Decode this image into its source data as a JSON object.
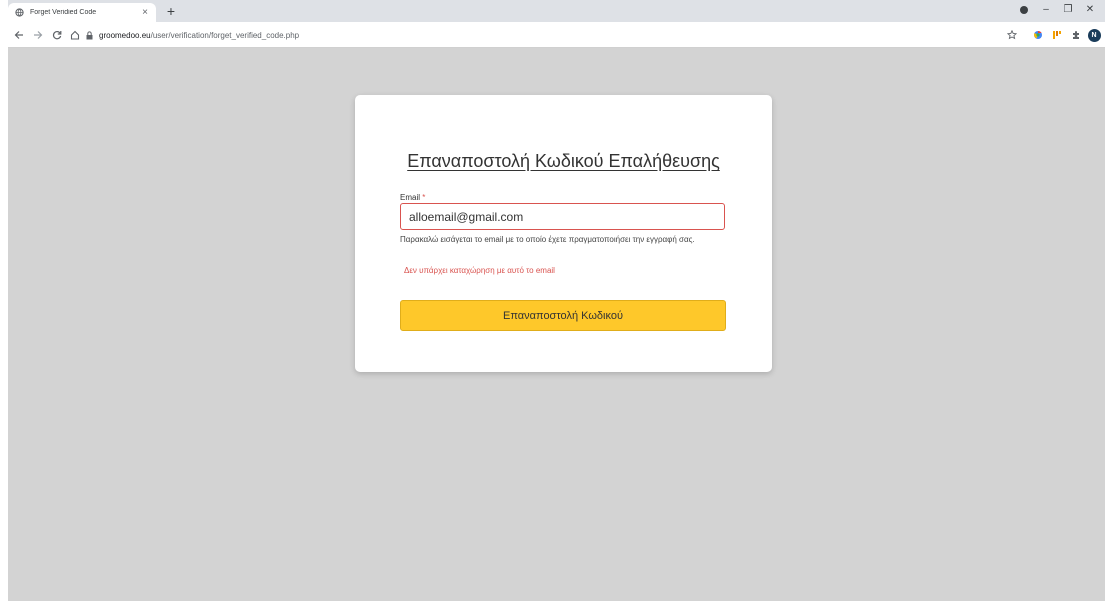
{
  "browser": {
    "tab_title": "Forget Veridied Code",
    "tab_close": "×",
    "new_tab": "+",
    "url_host": "groomedoo.eu",
    "url_path": "/user/verification/forget_verified_code.php",
    "profile_initial": "N",
    "window": {
      "minimize": "–",
      "maximize": "❐",
      "close": "✕"
    }
  },
  "form": {
    "title": "Επαναποστολή Κωδικού Επαλήθευσης",
    "email_label": "Email",
    "required_mark": "*",
    "email_value": "alloemail@gmail.com",
    "help_text": "Παρακαλώ εισάγεται το email με το οποίο έχετε πραγματοποιήσει την εγγραφή σας.",
    "error_text": "Δεν υπάρχει καταχώρηση με αυτό το email",
    "submit_label": "Επαναποστολή Κωδικού"
  },
  "colors": {
    "page_bg": "#d3d3d3",
    "accent_button": "#fec82a",
    "error": "#d9534f"
  },
  "icons": [
    "globe-icon",
    "back-arrow-icon",
    "forward-arrow-icon",
    "reload-icon",
    "home-icon",
    "lock-icon",
    "star-icon",
    "extension-icon",
    "puzzle-icon"
  ]
}
